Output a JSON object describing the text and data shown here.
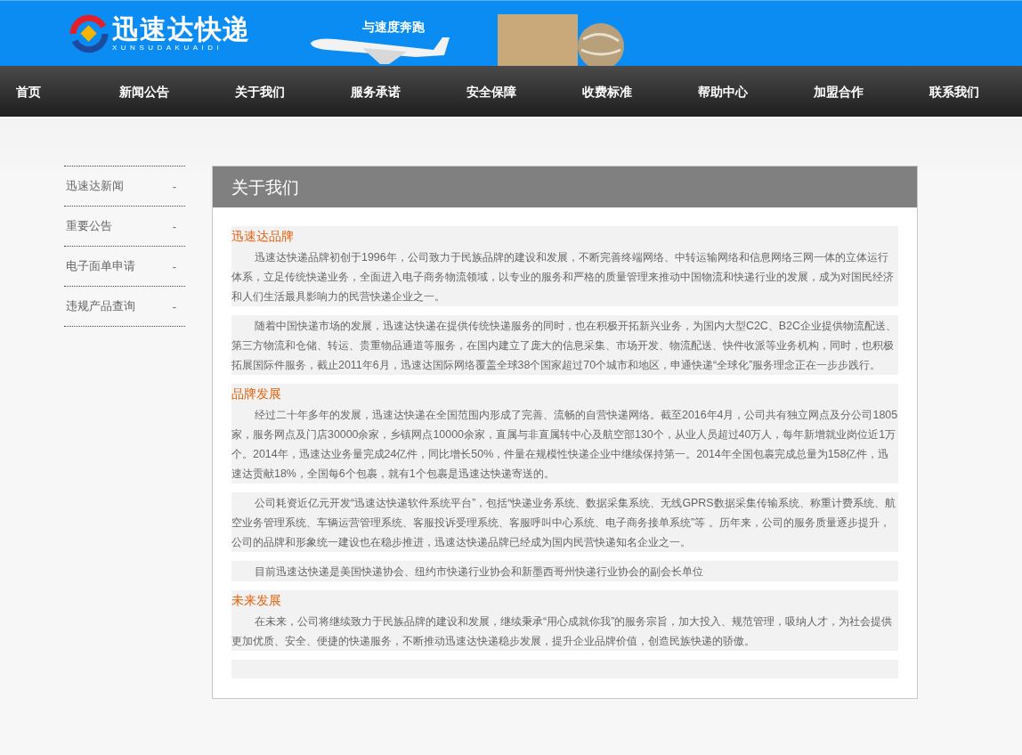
{
  "header": {
    "logo_text": "迅速达快递",
    "logo_subtext": "XUNSUDAKUAIDI",
    "slogan": "与速度奔跑"
  },
  "nav": [
    "首页",
    "新闻公告",
    "关于我们",
    "服务承诺",
    "安全保障",
    "收费标准",
    "帮助中心",
    "加盟合作",
    "联系我们"
  ],
  "sidebar": {
    "items": [
      {
        "label": "迅速达新闻",
        "marker": "-"
      },
      {
        "label": "重要公告",
        "marker": "-"
      },
      {
        "label": "电子面单申请",
        "marker": "-"
      },
      {
        "label": "违规产品查询",
        "marker": "-"
      }
    ]
  },
  "panel": {
    "title": "关于我们",
    "sections": [
      {
        "heading": "迅速达品牌",
        "paragraphs": [
          "迅速达快递品牌初创于1996年，公司致力于民族品牌的建设和发展，不断完善终端网络、中转运输网络和信息网络三网一体的立体运行体系，立足传统快递业务，全面进入电子商务物流领域，以专业的服务和严格的质量管理来推动中国物流和快递行业的发展，成为对国民经济和人们生活最具影响力的民营快递企业之一。",
          "随着中国快递市场的发展，迅速达快递在提供传统快递服务的同时，也在积极开拓新兴业务，为国内大型C2C、B2C企业提供物流配送、第三方物流和仓储、转运、贵重物品通道等服务，在国内建立了庞大的信息采集、市场开发、物流配送、快件收派等业务机构，同时，也积极拓展国际件服务，截止2011年6月，迅速达国际网络覆盖全球38个国家超过70个城市和地区，申通快递“全球化”服务理念正在一步步践行。"
        ]
      },
      {
        "heading": "品牌发展",
        "paragraphs": [
          "经过二十年多年的发展，迅速达快递在全国范围内形成了完善、流畅的自营快递网络。截至2016年4月，公司共有独立网点及分公司1805家，服务网点及门店30000余家，乡镇网点10000余家，直属与非直属转中心及航空部130个，从业人员超过40万人，每年新增就业岗位近1万个。2014年，迅速达业务量完成24亿件，同比增长50%，件量在规模性快递企业中继续保持第一。2014年全国包裹完成总量为158亿件，迅速达贡献18%，全国每6个包裹，就有1个包裹是迅速达快递寄送的。",
          "公司耗资近亿元开发“迅速达快递软件系统平台”，包括“快递业务系统、数据采集系统、无线GPRS数据采集传输系统、称重计费系统、航空业务管理系统、车辆运营管理系统、客服投诉受理系统、客服呼叫中心系统、电子商务接单系统”等 。历年来，公司的服务质量逐步提升，公司的品牌和形象统一建设也在稳步推进，迅速达快递品牌已经成为国内民营快递知名企业之一。",
          "目前迅速达快递是美国快递协会、纽约市快递行业协会和新墨西哥州快递行业协会的副会长单位"
        ]
      },
      {
        "heading": "未来发展",
        "paragraphs": [
          "在未来，公司将继续致力于民族品牌的建设和发展，继续秉承“用心成就你我”的服务宗旨，加大投入、规范管理，吸纳人才，为社会提供更加优质、安全、便捷的快递服务，不断推动迅速达快递稳步发展，提升企业品牌价值，创造民族快递的骄傲。"
        ]
      }
    ]
  }
}
